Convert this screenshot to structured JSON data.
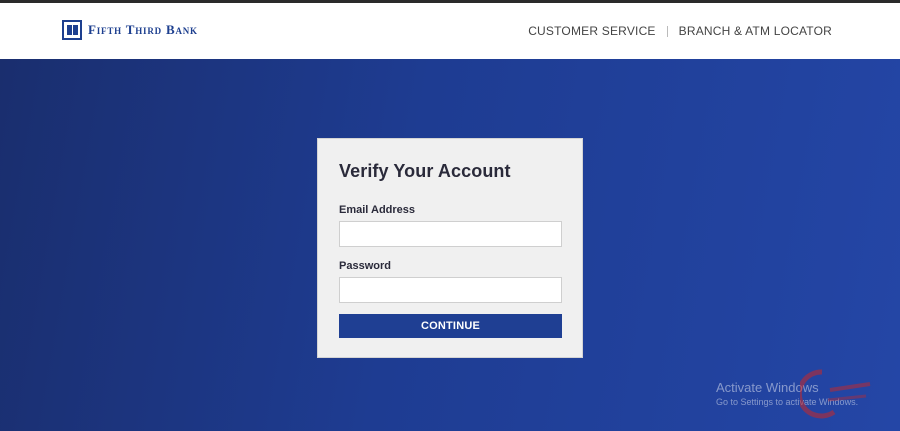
{
  "header": {
    "brand": "Fifth Third Bank",
    "nav": [
      "CUSTOMER SERVICE",
      "BRANCH & ATM LOCATOR"
    ]
  },
  "form": {
    "title": "Verify Your Account",
    "email_label": "Email Address",
    "email_value": "",
    "password_label": "Password",
    "password_value": "",
    "continue_label": "CONTINUE"
  },
  "watermark": {
    "line1": "Activate Windows",
    "line2": "Go to Settings to activate Windows."
  },
  "colors": {
    "brand_blue": "#1d3f8f",
    "button_blue": "#1f3f93",
    "hero_blue": "#1e3c92"
  }
}
